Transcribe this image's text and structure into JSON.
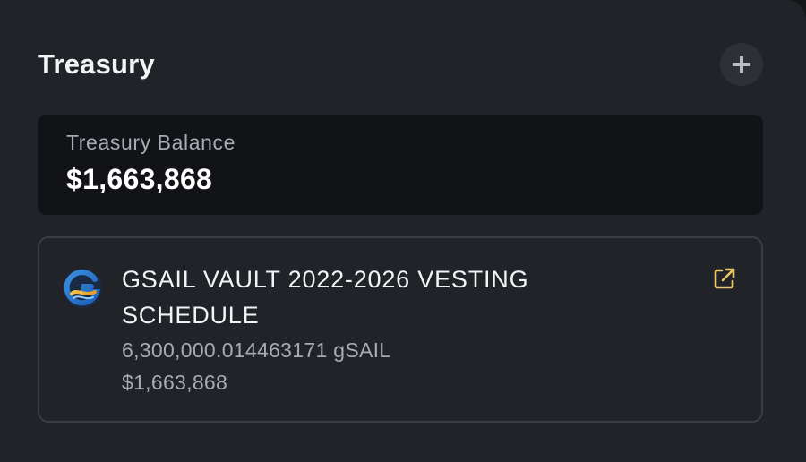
{
  "treasury": {
    "title": "Treasury",
    "add_button_icon": "plus-icon",
    "balance": {
      "label": "Treasury Balance",
      "value": "$1,663,868"
    },
    "assets": [
      {
        "logo_icon": "gsail-logo-icon",
        "name": "GSAIL VAULT 2022-2026 VESTING SCHEDULE",
        "amount": "6,300,000.014463171 gSAIL",
        "usd_value": "$1,663,868",
        "link_icon": "external-link-icon"
      }
    ]
  },
  "colors": {
    "panel_bg": "#212328",
    "card_bg": "#121317",
    "accent_link": "#e8c66a",
    "muted_text": "#a7abb3"
  }
}
